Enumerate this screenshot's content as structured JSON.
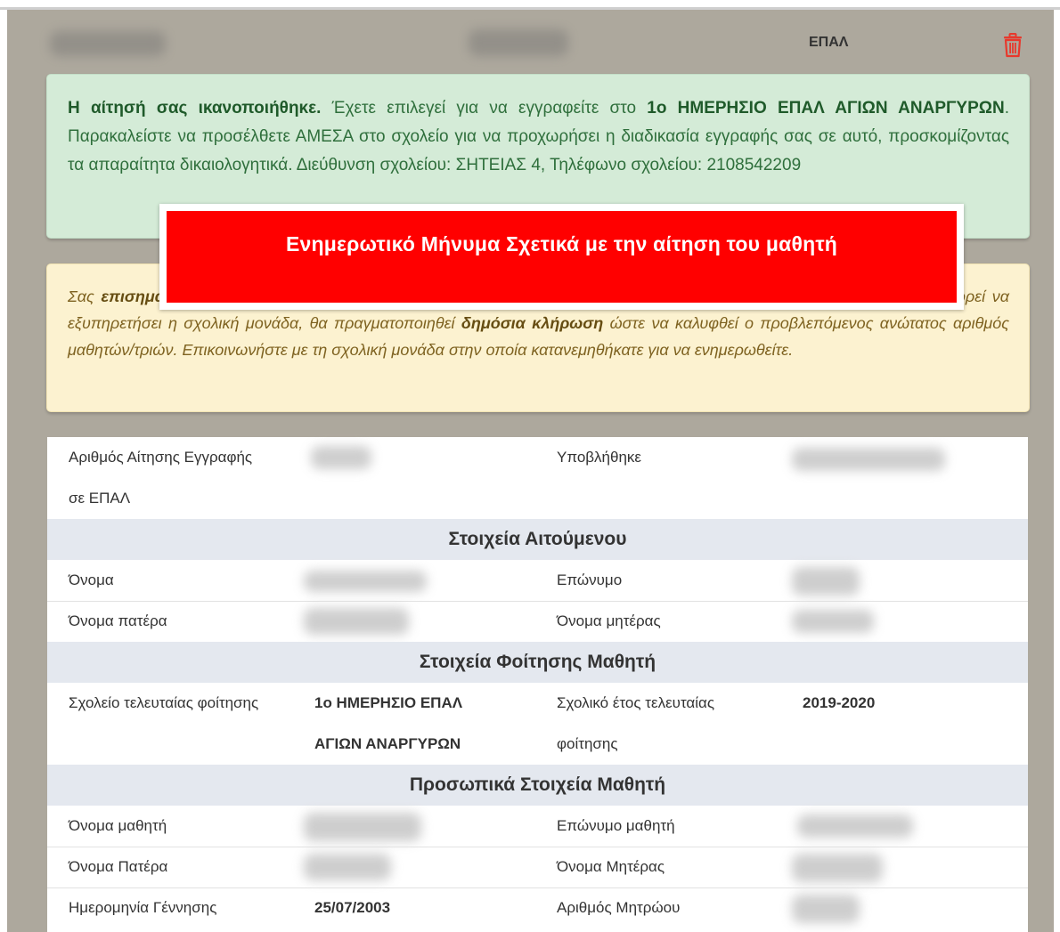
{
  "header": {
    "school_type": "ΕΠΑΛ",
    "delete_icon": "trash-icon",
    "delete_color": "#e8382c"
  },
  "success_alert": {
    "lead_bold": "Η αίτησή σας ικανοποιήθηκε.",
    "text_1": " Έχετε επιλεγεί για να εγγραφείτε στο ",
    "school_bold": "1ο ΗΜΕΡΗΣΙΟ ΕΠΑΛ ΑΓΙΩΝ ΑΝΑΡΓΥΡΩΝ",
    "text_2": ". Παρακαλείστε να προσέλθετε ΑΜΕΣΑ στο σχολείο για να προχωρήσει η διαδικασία εγγραφής σας σε αυτό, προσκομίζοντας τα απαραίτητα δικαιολογητικά. Διεύθυνση σχολείου: ΣΗΤΕΙΑΣ 4, Τηλέφωνο σχολείου: 2108542209",
    "color": "#d4ebd7"
  },
  "warning_alert": {
    "text_1": "Σας ",
    "bold_1": "επισημαίνουμε",
    "text_2": " ότι στην περίπτωση που ο αριθμός των αιτήσεων υπερβαίνει τον αριθμό των μαθητών/τριών που μπορεί να εξυπηρετήσει η σχολική μονάδα, θα πραγματοποιηθεί ",
    "bold_2": "δημόσια κλήρωση",
    "text_3": " ώστε να καλυφθεί ο προβλεπόμενος ανώτατος αριθμός μαθητών/τριών. Επικοινωνήστε με τη σχολική μονάδα στην οποία κατανεμηθήκατε για να ενημερωθείτε.",
    "color": "#fcf2d0"
  },
  "overlay": {
    "text": "Ενημερωτικό Μήνυμα Σχετικά με την αίτηση του μαθητή",
    "color": "#ff0000"
  },
  "application": {
    "number_label_1": "Αριθμός Αίτησης Εγγραφής",
    "number_label_2": "σε ΕΠΑΛ",
    "submitted_label": "Υποβλήθηκε"
  },
  "applicant": {
    "title": "Στοιχεία Αιτούμενου",
    "first_name_label": "Όνομα",
    "last_name_label": "Επώνυμο",
    "father_label": "Όνομα πατέρα",
    "mother_label": "Όνομα μητέρας"
  },
  "attendance": {
    "title": "Στοιχεία Φοίτησης Μαθητή",
    "last_school_label": "Σχολείο τελευταίας φοίτησης",
    "last_school_1": "1ο ΗΜΕΡΗΣΙΟ ΕΠΑΛ",
    "last_school_2": "ΑΓΙΩΝ ΑΝΑΡΓΥΡΩΝ",
    "last_year_label_1": "Σχολικό έτος τελευταίας",
    "last_year_label_2": "φοίτησης",
    "last_year": "2019-2020"
  },
  "student": {
    "title": "Προσωπικά Στοιχεία Μαθητή",
    "first_name_label": "Όνομα μαθητή",
    "last_name_label": "Επώνυμο μαθητή",
    "father_label": "Όνομα Πατέρα",
    "mother_label": "Όνομα Μητέρας",
    "birth_label": "Ημερομηνία Γέννησης",
    "birth_date": "25/07/2003",
    "registry_label": "Αριθμός Μητρώου"
  }
}
